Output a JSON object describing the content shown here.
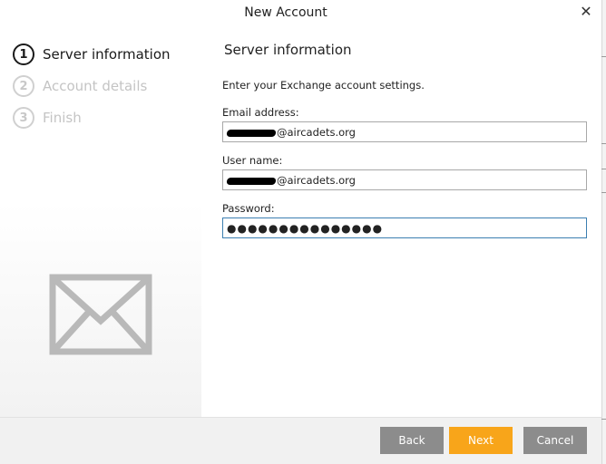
{
  "window": {
    "title": "New Account",
    "close_icon": "close-icon"
  },
  "steps": [
    {
      "number": "1",
      "label": "Server information",
      "state": "active"
    },
    {
      "number": "2",
      "label": "Account details",
      "state": "inactive"
    },
    {
      "number": "3",
      "label": "Finish",
      "state": "inactive"
    }
  ],
  "sidebar": {
    "icon": "envelope-icon"
  },
  "form": {
    "title": "Server information",
    "intro": "Enter your Exchange account settings.",
    "email": {
      "label": "Email address:",
      "value_suffix": "@aircadets.org"
    },
    "username": {
      "label": "User name:",
      "value_suffix": "@aircadets.org"
    },
    "password": {
      "label": "Password:",
      "value": "●●●●●●●●●●●●●●●"
    }
  },
  "footer": {
    "back_label": "Back",
    "next_label": "Next",
    "cancel_label": "Cancel"
  },
  "colors": {
    "accent": "#f8a51a",
    "button_gray": "#8c8c8c",
    "focus_border": "#3c7fb1"
  }
}
